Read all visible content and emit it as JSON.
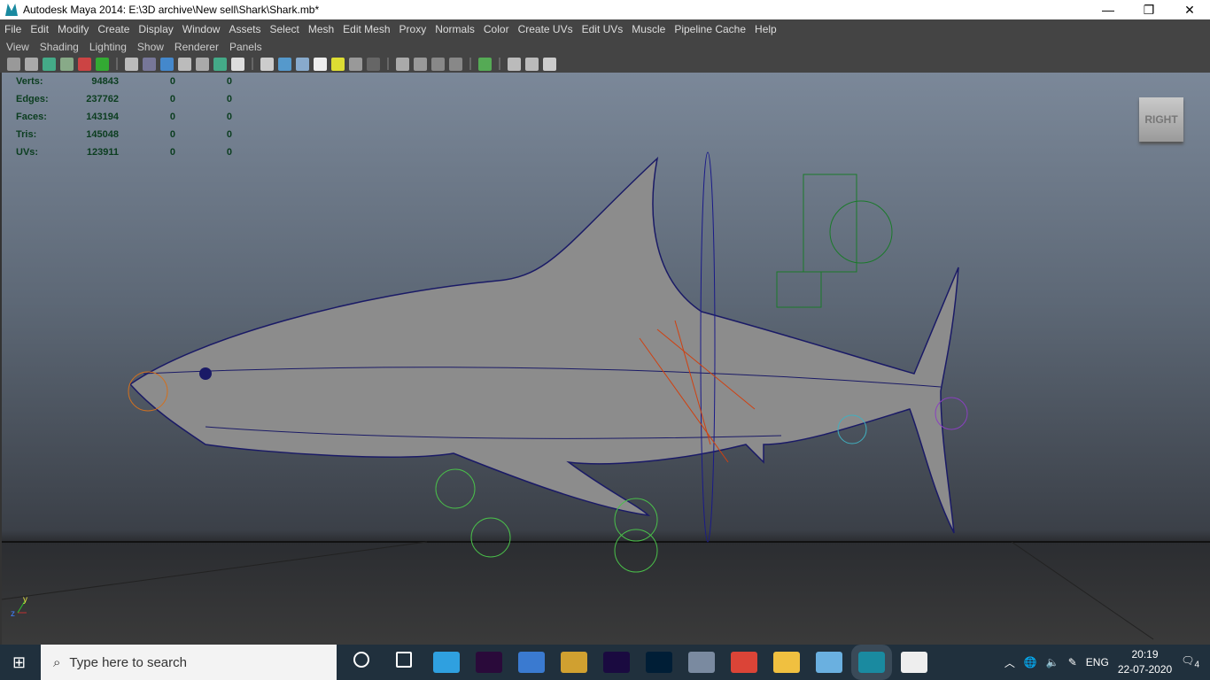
{
  "window": {
    "title": "Autodesk Maya 2014: E:\\3D archive\\New sell\\Shark\\Shark.mb*",
    "minimize": "—",
    "maximize": "❐",
    "close": "✕"
  },
  "menu": [
    "File",
    "Edit",
    "Modify",
    "Create",
    "Display",
    "Window",
    "Assets",
    "Select",
    "Mesh",
    "Edit Mesh",
    "Proxy",
    "Normals",
    "Color",
    "Create UVs",
    "Edit UVs",
    "Muscle",
    "Pipeline Cache",
    "Help"
  ],
  "panel_menu": [
    "View",
    "Shading",
    "Lighting",
    "Show",
    "Renderer",
    "Panels"
  ],
  "hud": [
    {
      "label": "Verts:",
      "value": "94843",
      "a": "0",
      "b": "0"
    },
    {
      "label": "Edges:",
      "value": "237762",
      "a": "0",
      "b": "0"
    },
    {
      "label": "Faces:",
      "value": "143194",
      "a": "0",
      "b": "0"
    },
    {
      "label": "Tris:",
      "value": "145048",
      "a": "0",
      "b": "0"
    },
    {
      "label": "UVs:",
      "value": "123911",
      "a": "0",
      "b": "0"
    }
  ],
  "view_cube": "RIGHT",
  "axis": {
    "y": "y",
    "z": "z"
  },
  "taskbar": {
    "search_placeholder": "Type here to search",
    "apps": [
      {
        "name": "cortana",
        "color": "#ffffff"
      },
      {
        "name": "task-view",
        "color": "#ffffff"
      },
      {
        "name": "edge",
        "color": "#2fa0e0"
      },
      {
        "name": "premiere",
        "color": "#2a0a3a"
      },
      {
        "name": "ie-browser",
        "color": "#3a7ad0"
      },
      {
        "name": "media-app",
        "color": "#d0a030"
      },
      {
        "name": "after-effects",
        "color": "#1a0a40"
      },
      {
        "name": "photoshop",
        "color": "#001e36"
      },
      {
        "name": "app-3d",
        "color": "#7a8aa0"
      },
      {
        "name": "chrome",
        "color": "#db4437"
      },
      {
        "name": "file-explorer",
        "color": "#f0c040"
      },
      {
        "name": "app-blue",
        "color": "#6ab0e0"
      },
      {
        "name": "maya",
        "color": "#1a8aa0"
      },
      {
        "name": "photos",
        "color": "#eeeeee"
      }
    ]
  },
  "tray": {
    "lang": "ENG",
    "time": "20:19",
    "date": "22-07-2020",
    "notifications": "4"
  }
}
